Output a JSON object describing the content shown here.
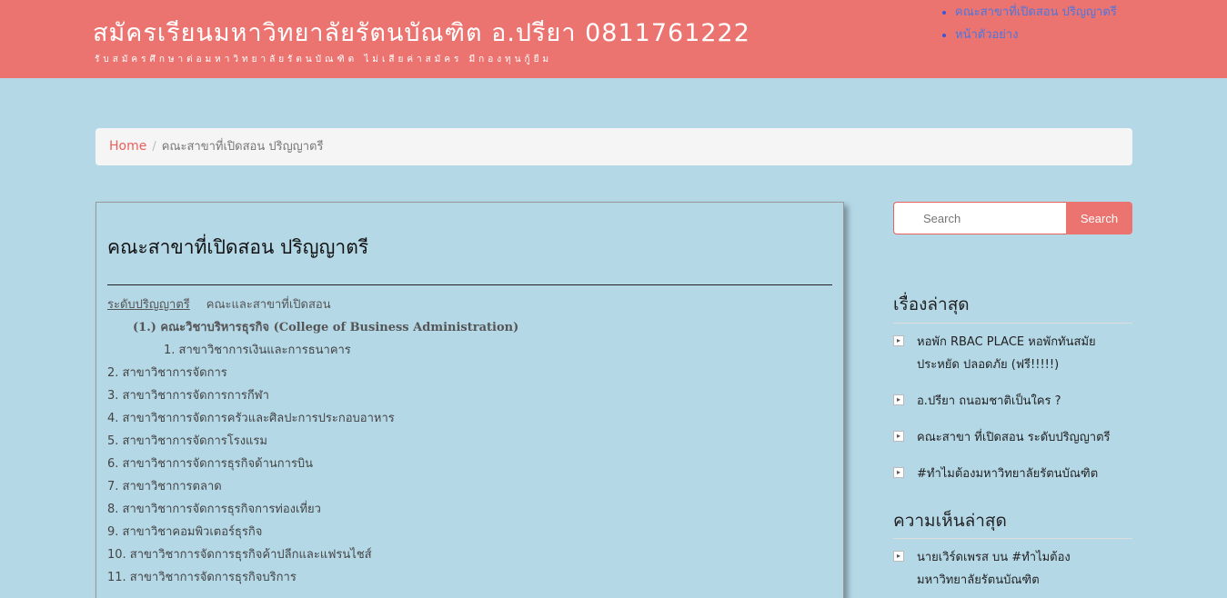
{
  "header": {
    "site_title": "สมัครเรียนมหาวิทยาลัยรัตนบัณฑิต อ.ปรียา 0811761222",
    "site_desc": "รับสมัครศึกษาต่อมหาวิทยาลัยรัตนบัณฑิต ไม่เสียค่าสมัคร มีกองทุนกู้ยืม",
    "nav": [
      {
        "label": "คณะสาขาที่เปิดสอน ปริญญาตรี"
      },
      {
        "label": "หน้าตัวอย่าง"
      }
    ]
  },
  "breadcrumb": {
    "home": "Home",
    "separator": "/",
    "current": "คณะสาขาที่เปิดสอน ปริญญาตรี"
  },
  "content": {
    "title": "คณะสาขาที่เปิดสอน ปริญญาตรี",
    "level_label": "ระดับปริญญาตรี",
    "level_head": "คณะและสาขาที่เปิดสอน",
    "college": "(1.) คณะวิชาบริหารธุรกิจ (College of Business Administration)",
    "first_major": "1. สาขาวิชาการเงินและการธนาคาร",
    "majors": [
      "2. สาขาวิชาการจัดการ",
      "3. สาขาวิชาการจัดการการกีฬา",
      "4. สาขาวิชาการจัดการครัวและศิลปะการประกอบอาหาร",
      "5. สาขาวิชาการจัดการโรงแรม",
      "6. สาขาวิชาการจัดการธุรกิจด้านการบิน",
      "7. สาขาวิชาการตลาด",
      "8. สาขาวิชาการจัดการธุรกิจการท่องเที่ยว",
      "9. สาขาวิชาคอมพิวเตอร์ธุรกิจ",
      "10. สาขาวิชาการจัดการธุรกิจค้าปลีกและแฟรนไชส์",
      "11. สาขาวิชาการจัดการธุรกิจบริการ"
    ]
  },
  "sidebar": {
    "search": {
      "placeholder": "Search",
      "button": "Search"
    },
    "recent_posts": {
      "title": "เรื่องล่าสุด",
      "items": [
        "หอพัก RBAC PLACE หอพักทันสมัย ประหยัด ปลอดภัย (ฟรี!!!!!)",
        "อ.ปรียา ถนอมชาติเป็นใคร ?",
        "คณะสาขา ที่เปิดสอน ระดับปริญญาตรี",
        "#ทำไมต้องมหาวิทยาลัยรัตนบัณฑิต"
      ]
    },
    "recent_comments": {
      "title": "ความเห็นล่าสุด",
      "items": [
        "นายเวิร์ดเพรส บน #ทำไมต้องมหาวิทยาลัยรัตนบัณฑิต"
      ]
    }
  },
  "colors": {
    "header_bg": "#eb7470",
    "page_bg": "#b5d8e7",
    "link": "#4a76e0",
    "accent": "#e8605b"
  }
}
